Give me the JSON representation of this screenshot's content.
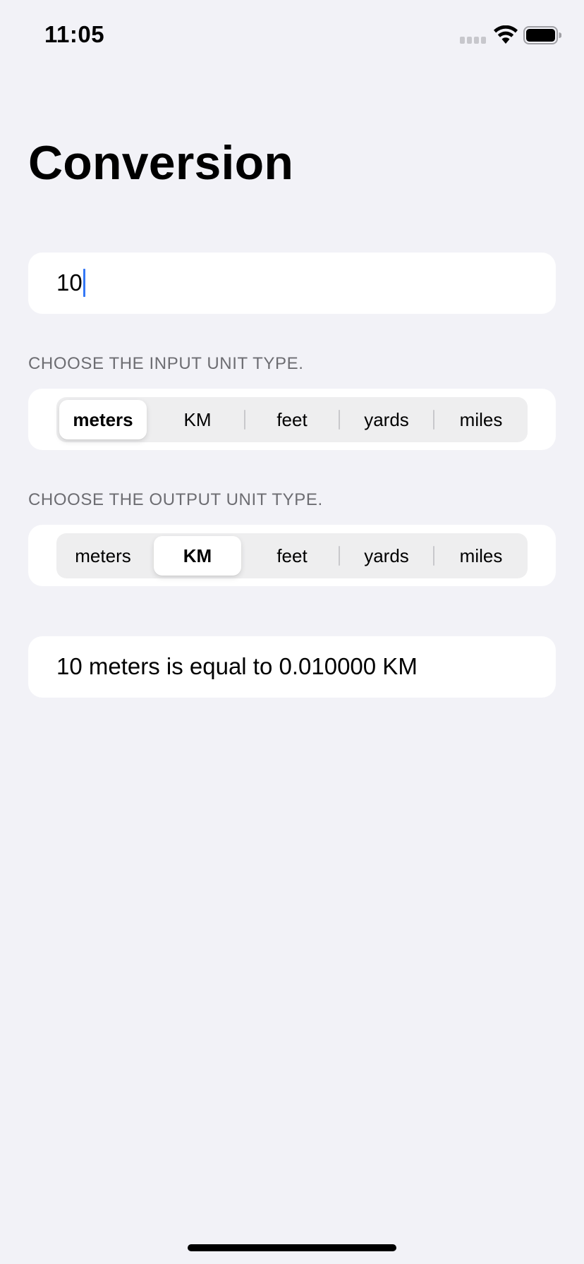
{
  "status_bar": {
    "time": "11:05",
    "icons": [
      "signal-icon",
      "wifi-icon",
      "battery-icon"
    ]
  },
  "page": {
    "title": "Conversion"
  },
  "input": {
    "value": "10"
  },
  "input_unit": {
    "header": "CHOOSE THE INPUT UNIT TYPE.",
    "options": [
      "meters",
      "KM",
      "feet",
      "yards",
      "miles"
    ],
    "selected": "meters"
  },
  "output_unit": {
    "header": "CHOOSE THE OUTPUT UNIT TYPE.",
    "options": [
      "meters",
      "KM",
      "feet",
      "yards",
      "miles"
    ],
    "selected": "KM"
  },
  "result": {
    "text": "10 meters is equal to 0.010000 KM"
  },
  "colors": {
    "background": "#f2f2f7",
    "card": "#ffffff",
    "caret": "#3478f6",
    "section_header": "#6d6d72"
  }
}
